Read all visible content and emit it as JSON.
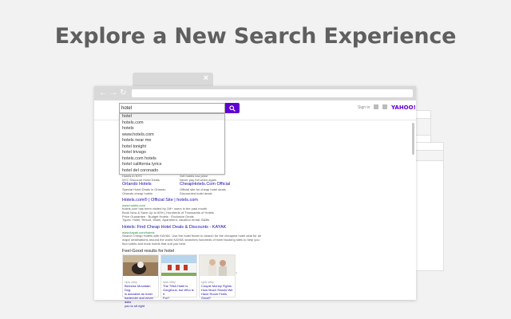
{
  "headline": "Explore a New Search Experience",
  "browser": {
    "tab_close": "×",
    "nav": {
      "back": "←",
      "forward": "→",
      "reload": "↻"
    }
  },
  "yahoo": {
    "logo": "YAHOO!",
    "sign_in": "Sign in",
    "query": "hotel"
  },
  "suggestions": [
    "hotel",
    "hotels.com",
    "hotels",
    "www.hotels.com",
    "hotels near me",
    "hotel tonight",
    "hotel trivago",
    "hotels.com hotels",
    "hotel california lyrics",
    "hotel del coronado"
  ],
  "results": {
    "left_col": [
      "Hotels in NYC",
      "NYC Discount Hotel Deals",
      "Orlando Hotels",
      "Special Hotel Deals in Orlando",
      "Orlando cheap hotels"
    ],
    "right_col": [
      "Get hotels low price",
      "Never pay full when again",
      "CheapHotels.Com Official",
      "Official site for cheap hotel deals",
      "Discounted hotel deals"
    ],
    "r1_title": "Hotels.com® | Official Site | hotels.com",
    "r1_url": "www.hotels.com",
    "r1_snip": [
      "hotels.com has been visited by 1M+ users in the past month",
      "Book Now & Save Up to 60% | Hundreds of Thousands of Hotels",
      "Price Guarantee · Budget Hotels · Exclusive Deals",
      "Types: Hotel, Resort, Motel, Apartment, vacation rental, B&Bs"
    ],
    "r2_title": "Hotels: Find Cheap Hotel Deals & Discounts - KAYAK",
    "r2_url": "www.kayak.com/hotels",
    "r2_snip": [
      "Search Cheap Hotels with KAYAK. Use the hotel finder to search for the cheapest hotel deal for all",
      "major destinations around the world KAYAK searches hundreds of hotel booking sites to help you",
      "find hotels and book hotels that suit you best."
    ],
    "feel_good": "Feel-Good results for hotel",
    "cards": [
      {
        "source": "Upw orthy",
        "title": "Bernese Mountain Dog\nis adorable as hotel\nbartender and never asks\nyou to sit right"
      },
      {
        "source": "Upw orthy",
        "title": "The TINA Hotel is\nGorgeous, but Who is it\nFor?"
      },
      {
        "source": "Upw orthy",
        "title": "Couple Money Fights:\nHow Much Should We\nHave Room Feels\nGood?"
      }
    ]
  }
}
